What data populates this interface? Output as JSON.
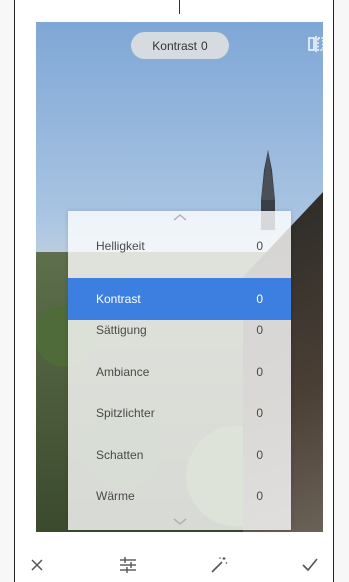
{
  "header": {
    "adjust_name": "Kontrast",
    "adjust_value": "0"
  },
  "menu": {
    "items": [
      {
        "label": "Helligkeit",
        "value": "0",
        "selected": false
      },
      {
        "label": "Kontrast",
        "value": "0",
        "selected": true
      },
      {
        "label": "Sättigung",
        "value": "0",
        "selected": false
      },
      {
        "label": "Ambiance",
        "value": "0",
        "selected": false
      },
      {
        "label": "Spitzlichter",
        "value": "0",
        "selected": false
      },
      {
        "label": "Schatten",
        "value": "0",
        "selected": false
      },
      {
        "label": "Wärme",
        "value": "0",
        "selected": false
      }
    ]
  },
  "toolbar": {
    "icons": [
      "close-icon",
      "sliders-icon",
      "magic-wand-icon",
      "checkmark-icon"
    ]
  },
  "colors": {
    "accent": "#3c7fe0"
  }
}
